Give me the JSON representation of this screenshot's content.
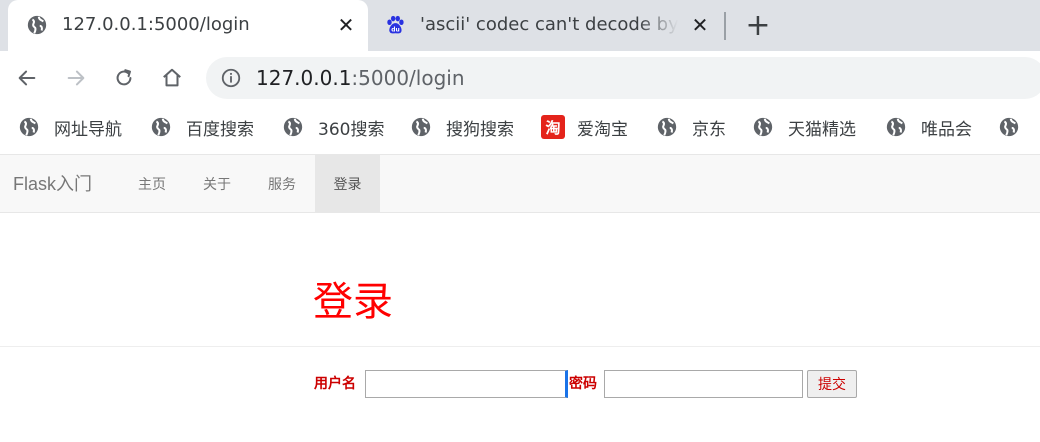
{
  "browser": {
    "tabs": [
      {
        "title": "127.0.0.1:5000/login",
        "active": true,
        "icon": "globe-icon"
      },
      {
        "title": "'ascii' codec can't decode byte",
        "active": false,
        "icon": "baidu-paw-icon"
      }
    ],
    "new_tab_label": "+",
    "close_glyph": "✕",
    "address": {
      "host": "127.0.0.1",
      "path": ":5000/login"
    },
    "colors": {
      "tabstrip": "#dee1e6",
      "omnibox": "#f1f3f4",
      "baidu_blue": "#2932e1",
      "taobao_red": "#e4231b"
    }
  },
  "bookmarks": [
    {
      "label": "网址导航",
      "icon": "globe-icon"
    },
    {
      "label": "百度搜索",
      "icon": "globe-icon"
    },
    {
      "label": "360搜索",
      "icon": "globe-icon"
    },
    {
      "label": "搜狗搜索",
      "icon": "globe-icon"
    },
    {
      "label": "爱淘宝",
      "icon": "taobao-icon",
      "icon_text": "淘"
    },
    {
      "label": "京东",
      "icon": "globe-icon"
    },
    {
      "label": "天猫精选",
      "icon": "globe-icon"
    },
    {
      "label": "唯品会",
      "icon": "globe-icon"
    },
    {
      "label": "",
      "icon": "globe-icon"
    }
  ],
  "site": {
    "brand": "Flask入门",
    "nav": [
      {
        "label": "主页",
        "active": false
      },
      {
        "label": "关于",
        "active": false
      },
      {
        "label": "服务",
        "active": false
      },
      {
        "label": "登录",
        "active": true
      }
    ],
    "heading": "登录",
    "form": {
      "username_label": "用户名",
      "username_value": "",
      "password_label": "密码",
      "password_value": "",
      "submit_label": "提交"
    },
    "colors": {
      "heading": "#ff0000",
      "labels": "#cc0000",
      "focus_caret": "#1a73e8"
    }
  }
}
